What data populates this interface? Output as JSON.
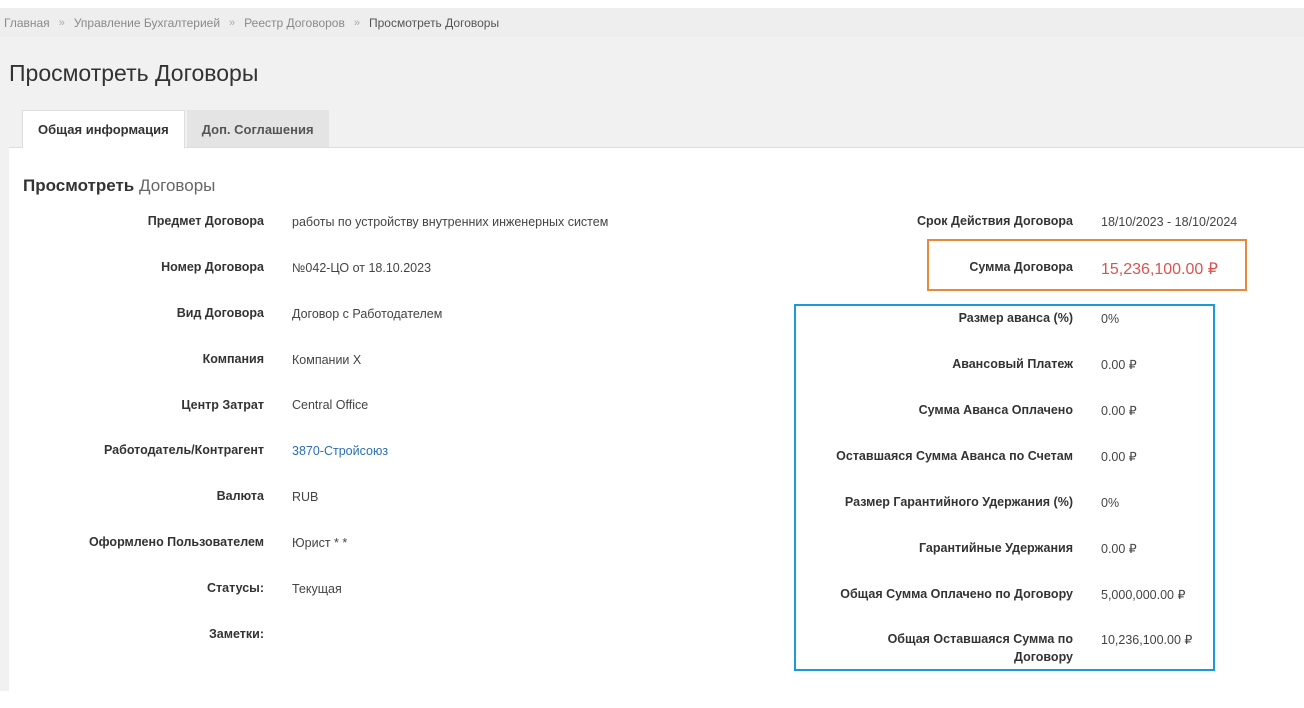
{
  "breadcrumb": {
    "items": [
      "Главная",
      "Управление Бухгалтерией",
      "Реестр Договоров"
    ],
    "current": "Просмотреть Договоры",
    "separator": "»"
  },
  "page_title": "Просмотреть Договоры",
  "tabs": [
    {
      "label": "Общая информация",
      "active": true
    },
    {
      "label": "Доп. Соглашения",
      "active": false
    }
  ],
  "section": {
    "bold": "Просмотреть",
    "light": "Договоры"
  },
  "left_fields": [
    {
      "label": "Предмет Договора",
      "value": "работы по устройству внутренних инженерных систем"
    },
    {
      "label": "Номер Договора",
      "value": "№042-ЦО от 18.10.2023"
    },
    {
      "label": "Вид Договора",
      "value": "Договор с Работодателем"
    },
    {
      "label": "Компания",
      "value": "Компании X"
    },
    {
      "label": "Центр Затрат",
      "value": "Central Office"
    },
    {
      "label": "Работодатель/Контрагент",
      "value": "3870-Стройсоюз"
    },
    {
      "label": "Валюта",
      "value": "RUB"
    },
    {
      "label": "Оформлено Пользователем",
      "value": "Юрист * *"
    },
    {
      "label": "Статусы:",
      "value": "Текущая"
    },
    {
      "label": "Заметки:",
      "value": ""
    }
  ],
  "right_fields": [
    {
      "label": "Срок Действия Договора",
      "value": "18/10/2023 - 18/10/2024"
    },
    {
      "label": "Сумма Договора",
      "value": "15,236,100.00 ₽"
    },
    {
      "label": "Размер аванса (%)",
      "value": "0%"
    },
    {
      "label": "Авансовый Платеж",
      "value": "0.00 ₽"
    },
    {
      "label": "Сумма Аванса Оплачено",
      "value": "0.00 ₽"
    },
    {
      "label": "Оставшаяся Сумма Аванса по Счетам",
      "value": "0.00 ₽"
    },
    {
      "label": "Размер Гарантийного Удержания (%)",
      "value": "0%"
    },
    {
      "label": "Гарантийные Удержания",
      "value": "0.00 ₽"
    },
    {
      "label": "Общая Сумма Оплачено по Договору",
      "value": "5,000,000.00 ₽"
    },
    {
      "label": "Общая Оставшаяся Сумма по Договору",
      "value": "10,236,100.00 ₽"
    }
  ],
  "colors": {
    "amount": "#d9534f",
    "link": "#2b6fb0",
    "highlight_orange": "#e8883a",
    "highlight_blue": "#1a9bd7"
  }
}
